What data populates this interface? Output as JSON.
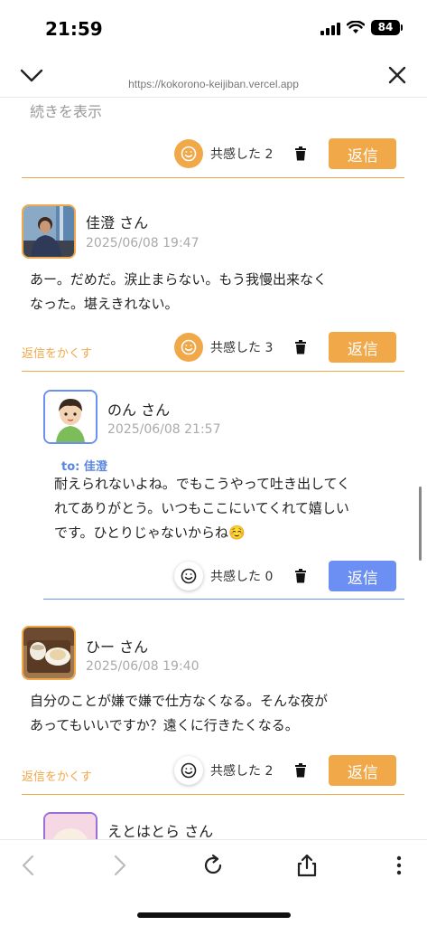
{
  "status": {
    "time": "21:59",
    "battery": "84"
  },
  "browser": {
    "url": "https://kokorono-keijiban.vercel.app"
  },
  "top": {
    "more_label": "続きを表示",
    "empathy": "共感した 2",
    "reply": "返信"
  },
  "posts": [
    {
      "name": "佳澄 さん",
      "date": "2025/06/08 19:47",
      "body_line1": "あー。だめだ。涙止まらない。もう我慢出来なく",
      "body_line2": "なった。堪えきれない。",
      "hide_label": "返信をかくす",
      "empathy": "共感した 3",
      "reply": "返信"
    },
    {
      "name": "のん さん",
      "date": "2025/06/08 21:57",
      "to": "to: 佳澄",
      "body_line1": "耐えられないよね。でもこうやって吐き出してく",
      "body_line2": "れてありがとう。いつもここにいてくれて嬉しい",
      "body_line3": "です。ひとりじゃないからね☺️",
      "empathy": "共感した 0",
      "reply": "返信"
    },
    {
      "name": "ひー さん",
      "date": "2025/06/08 19:40",
      "body_line1": "自分のことが嫌で嫌で仕方なくなる。そんな夜が",
      "body_line2": "あってもいいですか？遠くに行きたくなる。",
      "hide_label": "返信をかくす",
      "empathy": "共感した 2",
      "reply": "返信"
    },
    {
      "name": "えとはとら さん"
    }
  ],
  "colors": {
    "accent_orange": "#f0a848",
    "accent_blue": "#6b8ff2"
  },
  "icons": [
    "chevron-down-icon",
    "close-icon",
    "smile-icon",
    "trash-icon",
    "back-icon",
    "forward-icon",
    "reload-icon",
    "share-icon",
    "more-icon"
  ]
}
